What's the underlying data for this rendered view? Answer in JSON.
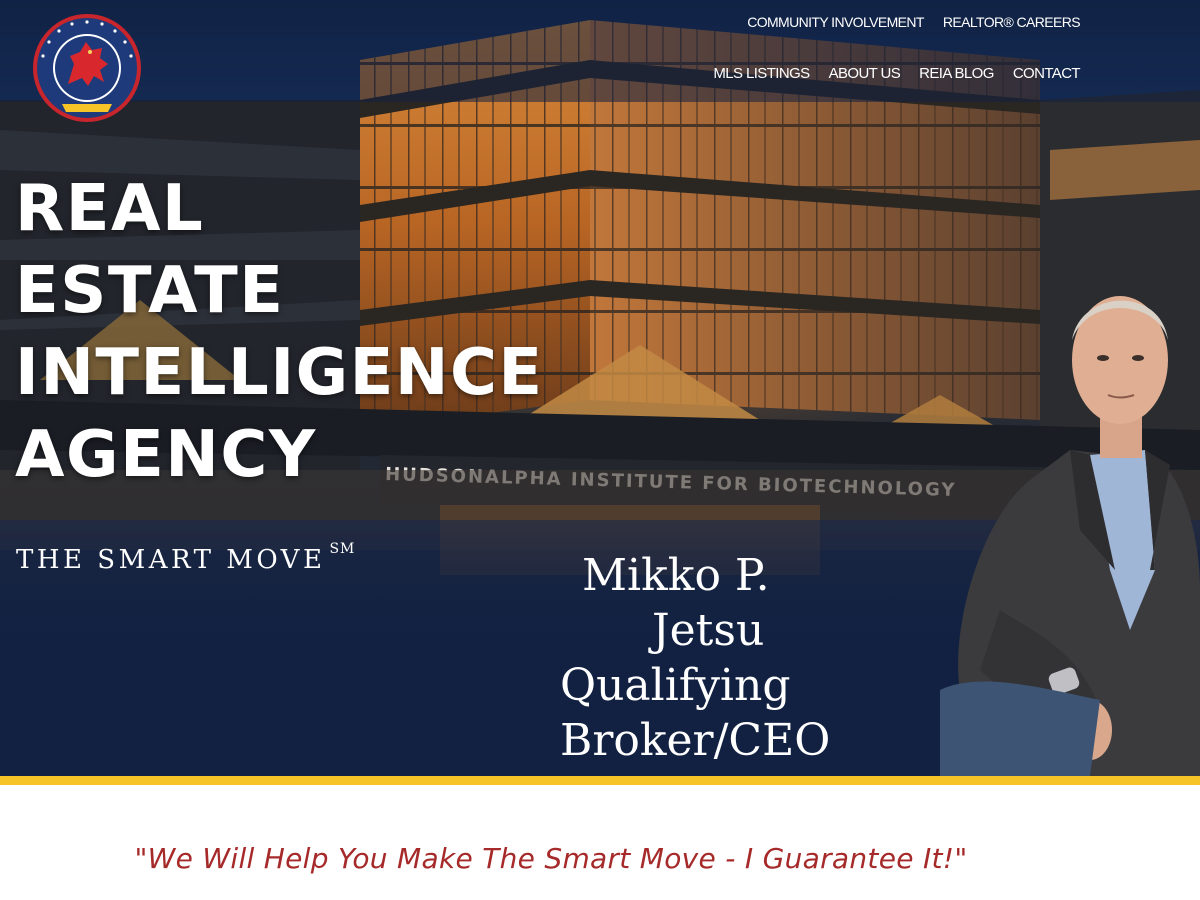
{
  "brand": {
    "logo_alt": "REAL ESTATE INTELLIGENCE AGENCY — THE SMART MOVE"
  },
  "nav": {
    "top": [
      {
        "label": "COMMUNITY INVOLVEMENT"
      },
      {
        "label": "REALTOR® CAREERS"
      }
    ],
    "main": [
      {
        "label": "MLS LISTINGS"
      },
      {
        "label": "ABOUT US"
      },
      {
        "label": "REIA BLOG"
      },
      {
        "label": "CONTACT"
      }
    ]
  },
  "hero": {
    "headline": [
      "REAL",
      "ESTATE",
      "INTELLIGENCE",
      "AGENCY"
    ],
    "tagline": "THE SMART MOVE",
    "tagline_mark": "SM",
    "building_sign": "HUDSONALPHA INSTITUTE FOR BIOTECHNOLOGY",
    "person": {
      "name_line1": "Mikko P.",
      "name_line2": "Jetsu",
      "title_line1": "Qualifying",
      "title_line2": "Broker/CEO"
    }
  },
  "quote": "\"We Will Help You Make The Smart Move - I Guarantee It!\"",
  "colors": {
    "navy": "#122142",
    "accent_yellow": "#f7c428",
    "quote_red": "#a62a2a",
    "logo_red": "#c8252c"
  }
}
